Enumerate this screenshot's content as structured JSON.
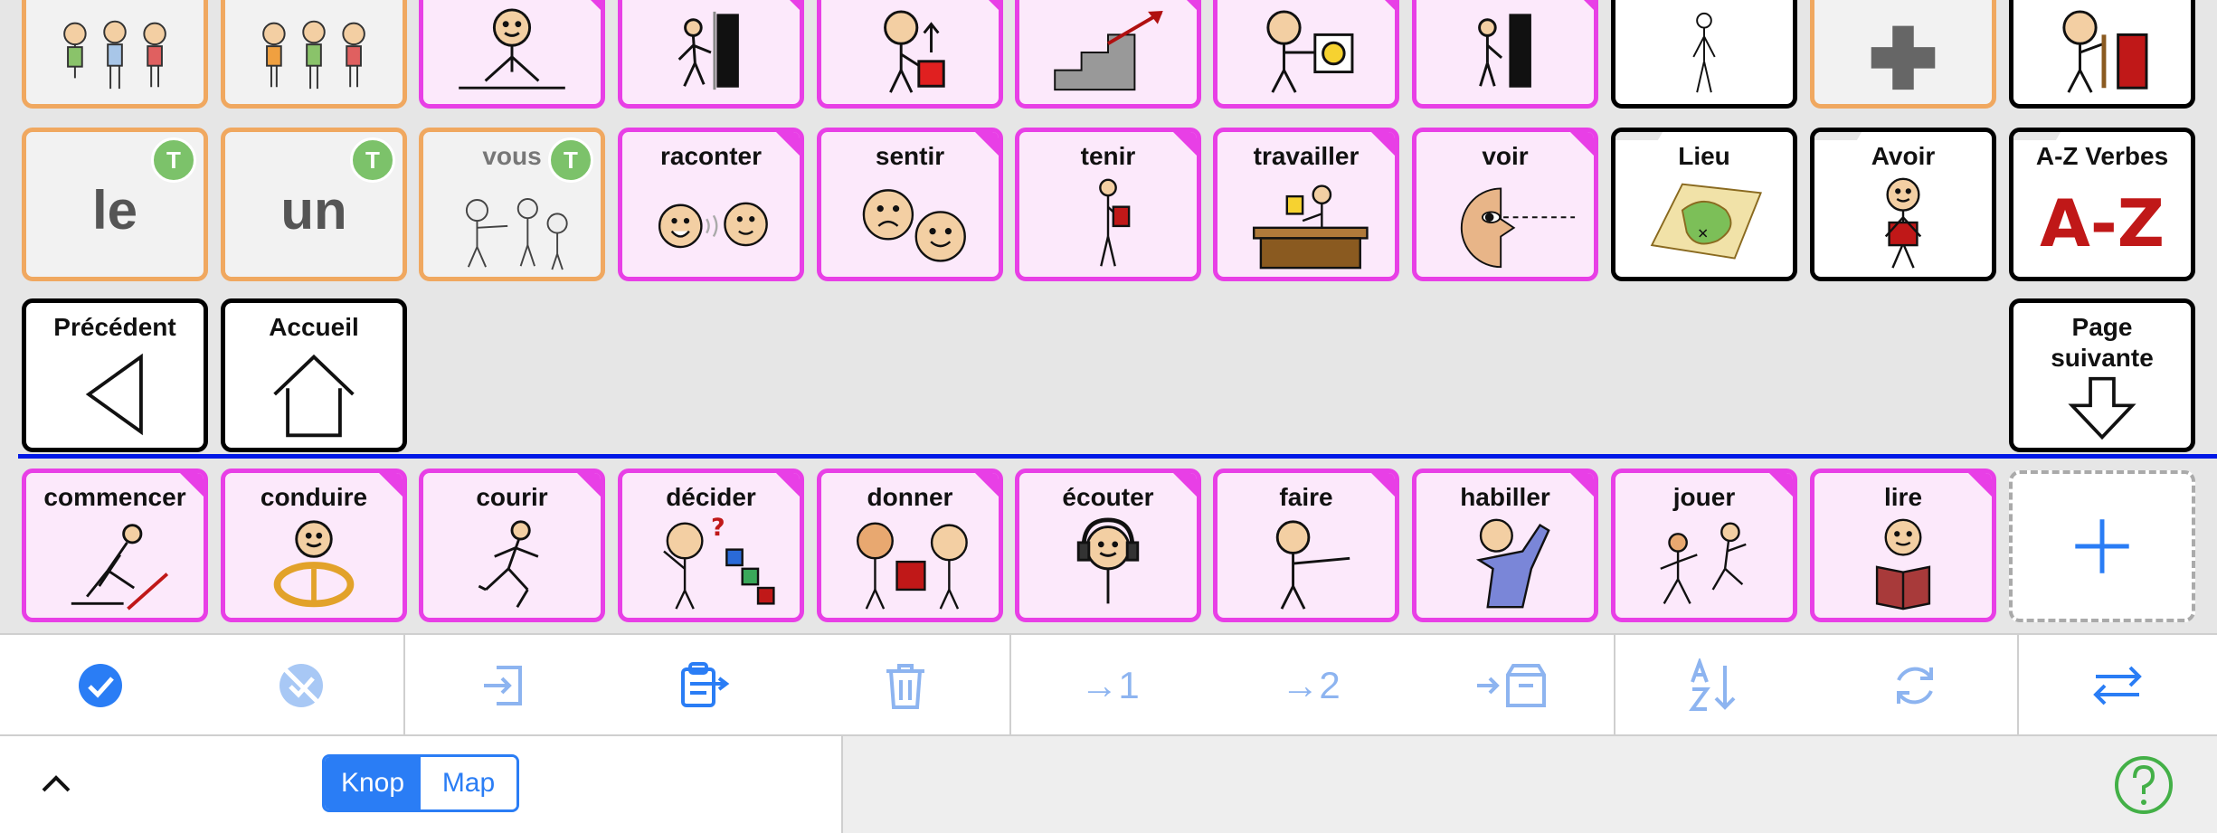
{
  "grid": {
    "row1": [
      {
        "kind": "det",
        "label": ""
      },
      {
        "kind": "det",
        "label": ""
      },
      {
        "kind": "verb",
        "label": ""
      },
      {
        "kind": "verb",
        "label": ""
      },
      {
        "kind": "verb",
        "label": ""
      },
      {
        "kind": "verb",
        "label": ""
      },
      {
        "kind": "verb",
        "label": ""
      },
      {
        "kind": "verb",
        "label": ""
      },
      {
        "kind": "folder",
        "label": ""
      },
      {
        "kind": "det",
        "label": ""
      },
      {
        "kind": "folder",
        "label": ""
      }
    ],
    "row2": {
      "le": "le",
      "un": "un",
      "vous": "vous",
      "raconter": "raconter",
      "sentir": "sentir",
      "tenir": "tenir",
      "travailler": "travailler",
      "voir": "voir",
      "lieu": "Lieu",
      "avoir": "Avoir",
      "az": "A-Z Verbes",
      "az_glyph": "A-Z",
      "badge": "T"
    },
    "row3": {
      "previous": "Précédent",
      "home": "Accueil",
      "next": "Page suivante"
    },
    "row4": [
      "commencer",
      "conduire",
      "courir",
      "décider",
      "donner",
      "écouter",
      "faire",
      "habiller",
      "jouer",
      "lire"
    ]
  },
  "toolbar": {
    "to1": "→1",
    "to2": "→2",
    "items": [
      "select-all",
      "deselect",
      "move-to",
      "paste",
      "delete",
      "move-to-1",
      "move-to-2",
      "move-to-storage",
      "sort",
      "refresh",
      "swap"
    ]
  },
  "bottom": {
    "segment_left": "Knop",
    "segment_right": "Map",
    "selected": "Knop"
  },
  "colors": {
    "verb_border": "#e83fe6",
    "verb_bg": "#fce9fb",
    "det_border": "#f0a860",
    "accent": "#2a7df5",
    "help": "#43b047",
    "divider": "#0018e6"
  }
}
